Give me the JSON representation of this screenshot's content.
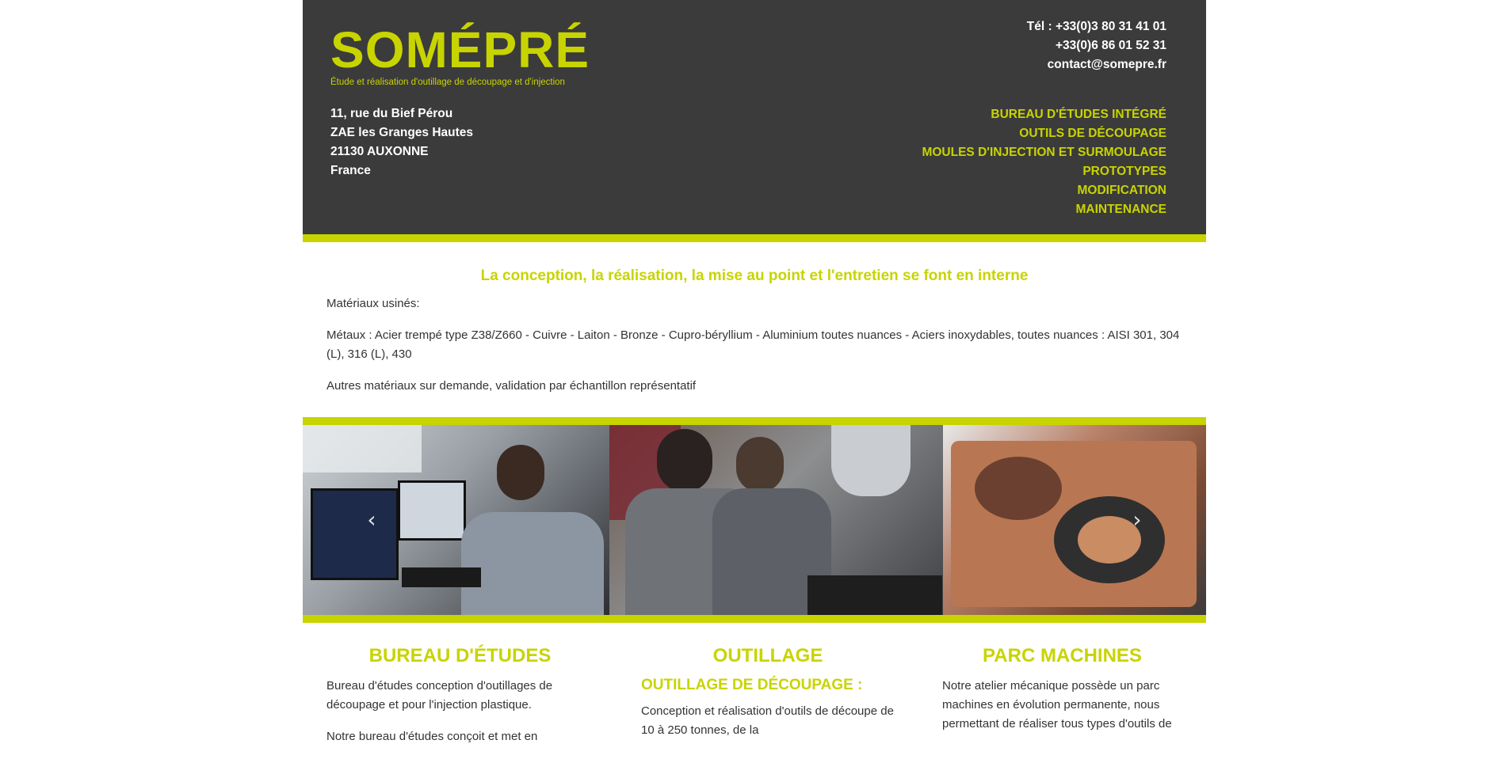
{
  "brand": {
    "name": "SOMÉPRÉ",
    "tagline": "Étude et réalisation d'outillage de découpage et d'injection",
    "accent_color": "#c8d400",
    "header_bg": "#3b3b3b"
  },
  "address": {
    "line1": "11, rue du Bief Pérou",
    "line2": "ZAE les Granges Hautes",
    "line3": "21130 AUXONNE",
    "line4": "France"
  },
  "contact": {
    "phone1": "Tél : +33(0)3 80 31 41 01",
    "phone2": "+33(0)6 86 01 52 31",
    "email": "contact@somepre.fr"
  },
  "nav": [
    "BUREAU D'ÉTUDES INTÉGRÉ",
    "OUTILS DE DÉCOUPAGE",
    "MOULES D'INJECTION ET SURMOULAGE",
    "PROTOTYPES",
    "MODIFICATION",
    "MAINTENANCE"
  ],
  "intro": {
    "heading": "La conception, la réalisation, la mise au point et l'entretien se font en interne",
    "p1": "Matériaux usinés:",
    "p2": "Métaux : Acier trempé type Z38/Z660 - Cuivre - Laiton - Bronze - Cupro-béryllium - Aluminium toutes nuances - Aciers inoxydables, toutes nuances : AISI 301, 304 (L), 316 (L), 430",
    "p3": "Autres matériaux sur demande, validation par échantillon représentatif"
  },
  "carousel": {
    "prev_icon": "‹",
    "next_icon": "›"
  },
  "sections": {
    "bureau": {
      "title": "BUREAU D'ÉTUDES",
      "p1": "Bureau d'études conception d'outillages de découpage et pour l'injection plastique.",
      "p2": "Notre bureau d'études conçoit et met en"
    },
    "outillage": {
      "title": "OUTILLAGE",
      "subtitle": "OUTILLAGE DE DÉCOUPAGE :",
      "p1": "Conception et réalisation d'outils de découpe de 10 à 250 tonnes, de la"
    },
    "parc": {
      "title": "PARC MACHINES",
      "p1": "Notre atelier mécanique possède un parc machines en évolution permanente, nous permettant de réaliser tous types d'outils de"
    }
  }
}
